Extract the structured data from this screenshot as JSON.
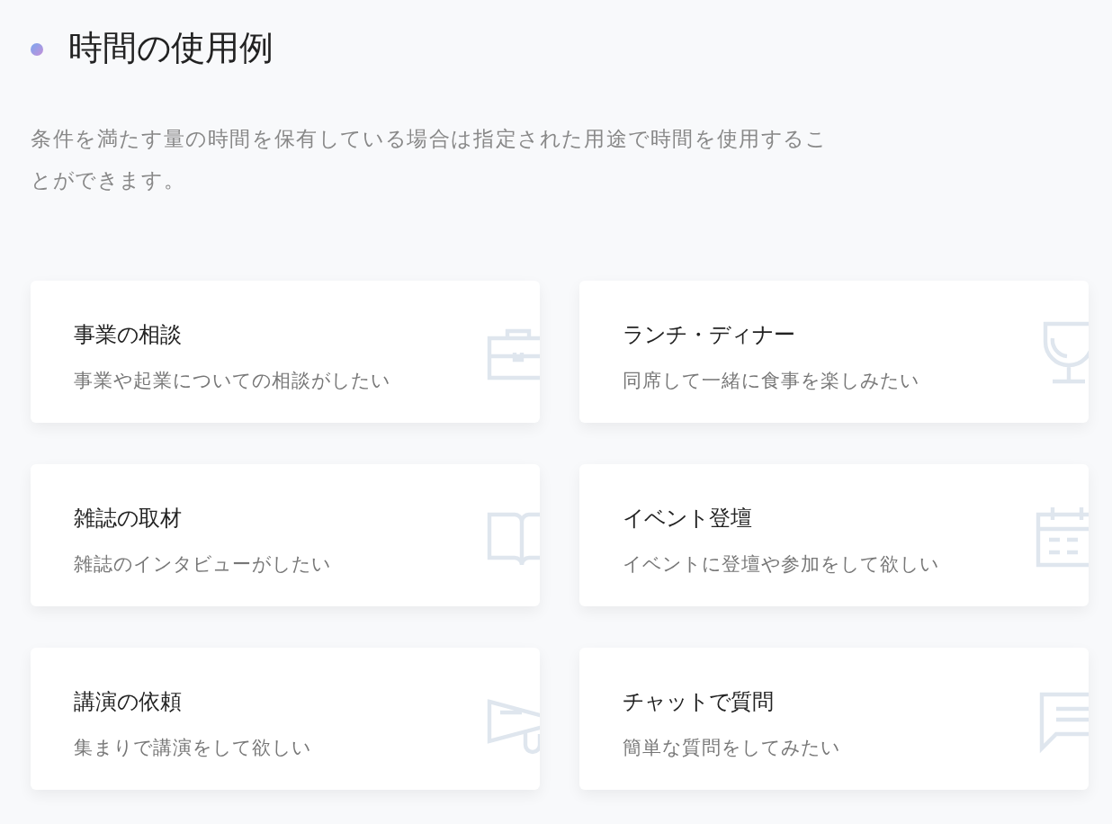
{
  "section": {
    "title": "時間の使用例",
    "description": "条件を満たす量の時間を保有している場合は指定された用途で時間を使用することができます。"
  },
  "cards": [
    {
      "title": "事業の相談",
      "text": "事業や起業についての相談がしたい",
      "kind": "briefcase"
    },
    {
      "title": "ランチ・ディナー",
      "text": "同席して一緒に食事を楽しみたい",
      "kind": "glass"
    },
    {
      "title": "雑誌の取材",
      "text": "雑誌のインタビューがしたい",
      "kind": "book"
    },
    {
      "title": "イベント登壇",
      "text": "イベントに登壇や参加をして欲しい",
      "kind": "calendar"
    },
    {
      "title": "講演の依頼",
      "text": "集まりで講演をして欲しい",
      "kind": "megaphone"
    },
    {
      "title": "チャットで質問",
      "text": "簡単な質問をしてみたい",
      "kind": "chat"
    }
  ]
}
